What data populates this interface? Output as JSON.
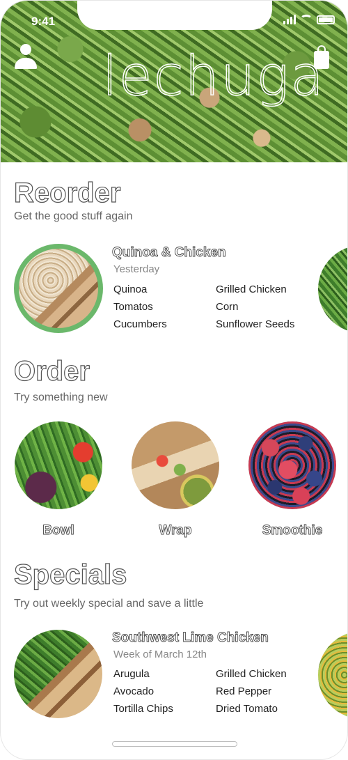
{
  "status_bar": {
    "time": "9:41"
  },
  "header": {
    "logo_text": "lechuga"
  },
  "reorder": {
    "title": "Reorder",
    "subtitle": "Get the good stuff again",
    "card": {
      "name": "Quinoa & Chicken",
      "date": "Yesterday",
      "ingredients": [
        "Quinoa",
        "Grilled Chicken",
        "Tomatos",
        "Corn",
        "Cucumbers",
        "Sunflower Seeds"
      ]
    }
  },
  "order": {
    "title": "Order",
    "subtitle": "Try something new",
    "items": [
      {
        "label": "Bowl"
      },
      {
        "label": "Wrap"
      },
      {
        "label": "Smoothie"
      }
    ]
  },
  "specials": {
    "title": "Specials",
    "subtitle": "Try out weekly special and save a little",
    "card": {
      "name": "Southwest Lime Chicken",
      "date": "Week of March 12th",
      "ingredients": [
        "Arugula",
        "Grilled Chicken",
        "Avocado",
        "Red Pepper",
        "Tortilla Chips",
        "Dried Tomato"
      ]
    }
  },
  "colors": {
    "accent_ring": "#6bb86b"
  },
  "icons": [
    "profile-icon",
    "shopping-bag-icon",
    "signal-icon",
    "wifi-icon",
    "battery-icon"
  ]
}
